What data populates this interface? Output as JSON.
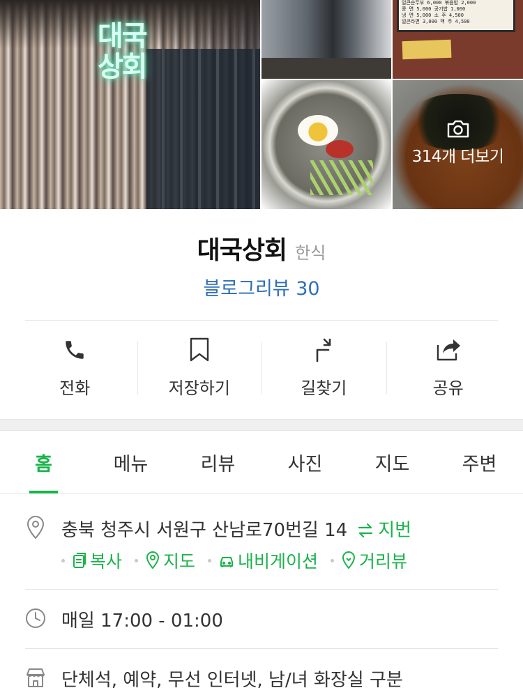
{
  "photos": {
    "neon_sign": "대국\n상회",
    "menu_board": [
      "얼큰순두부 6,000 볶음밥 2,000",
      "콩 면 5,000 공기밥 1,000",
      "냉 면 5,000 소 주 4,500",
      "얼큰라면 3,000 맥 주 4,500"
    ],
    "more_label": "314개 더보기"
  },
  "place": {
    "name": "대국상회",
    "category": "한식",
    "blog_review": "블로그리뷰 30"
  },
  "actions": [
    {
      "label": "전화",
      "icon": "phone-icon"
    },
    {
      "label": "저장하기",
      "icon": "bookmark-icon"
    },
    {
      "label": "길찾기",
      "icon": "directions-icon"
    },
    {
      "label": "공유",
      "icon": "share-icon"
    }
  ],
  "tabs": [
    {
      "label": "홈",
      "active": true
    },
    {
      "label": "메뉴"
    },
    {
      "label": "리뷰"
    },
    {
      "label": "사진"
    },
    {
      "label": "지도"
    },
    {
      "label": "주변"
    }
  ],
  "info": {
    "address": "충북 청주시 서원구 산남로70번길 14",
    "jibeon_label": "지번",
    "links": {
      "copy": "복사",
      "map": "지도",
      "navigation": "내비게이션",
      "street_view": "거리뷰"
    },
    "hours": "매일 17:00 - 01:00",
    "amenities": "단체석, 예약, 무선 인터넷, 남/녀 화장실 구분"
  },
  "colors": {
    "accent_green": "#19b34a",
    "link_blue": "#2e6fb6"
  }
}
